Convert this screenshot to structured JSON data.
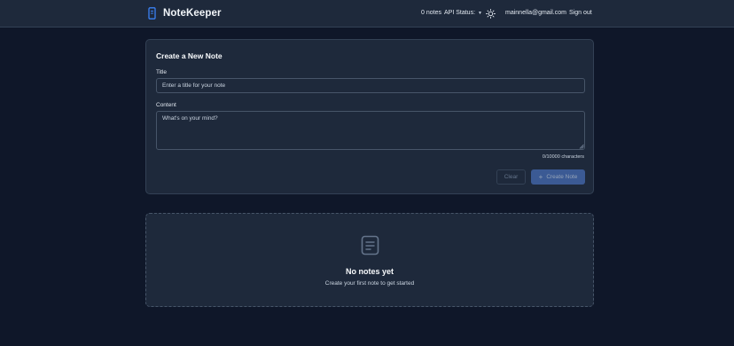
{
  "app": {
    "name": "NoteKeeper",
    "logo_icon": "notebook-icon"
  },
  "header": {
    "notes_count": "0 notes",
    "api_status_label": "API Status:",
    "api_status_caret": "▼",
    "theme_icon": "sun-icon",
    "user_email": "mainnella@gmail.com",
    "sign_out_label": "Sign out"
  },
  "create_note": {
    "title": "Create a New Note",
    "title_label": "Title",
    "title_placeholder": "Enter a title for your note",
    "title_value": "",
    "content_label": "Content",
    "content_placeholder": "What's on your mind?",
    "content_value": "",
    "char_count": "0/10000 characters",
    "clear_label": "Clear",
    "create_icon": "+",
    "create_label": "Create Note"
  },
  "empty_state": {
    "icon": "document-icon",
    "title": "No notes yet",
    "subtitle": "Create your first note to get started"
  },
  "colors": {
    "background": "#0f1729",
    "surface": "#1e293b",
    "border": "#334155",
    "accent": "#3b5a94",
    "brand": "#3b82f6"
  }
}
